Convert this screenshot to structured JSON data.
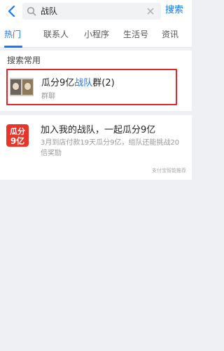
{
  "search": {
    "query": "战队",
    "action_label": "搜索"
  },
  "tabs": [
    {
      "label": "热门",
      "active": true
    },
    {
      "label": "联系人",
      "active": false
    },
    {
      "label": "小程序",
      "active": false
    },
    {
      "label": "生活号",
      "active": false
    },
    {
      "label": "资讯",
      "active": false
    }
  ],
  "frequent": {
    "title": "搜索常用",
    "item": {
      "name_prefix": "瓜分9亿",
      "name_highlight": "战队",
      "name_suffix": "群(2)",
      "subtitle": "群聊"
    }
  },
  "promo": {
    "logo_text_top": "瓜分",
    "logo_text_bottom": "9亿",
    "title": "加入我的战队，一起瓜分9亿",
    "description": "3月到店付款19天瓜分9亿，组队还能挑战20倍奖励",
    "source": "支付宝智能推荐"
  },
  "colors": {
    "accent": "#1677ff",
    "highlight_border": "#e0262c",
    "promo_red": "#e8352b"
  }
}
